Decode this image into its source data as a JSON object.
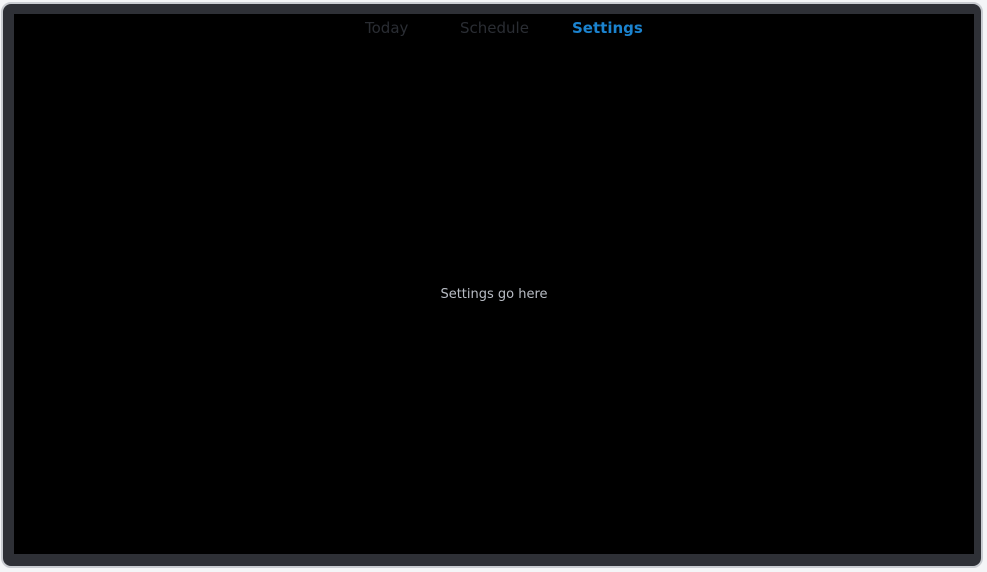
{
  "tabs": [
    {
      "label": "Today",
      "active": false
    },
    {
      "label": "Schedule",
      "active": false
    },
    {
      "label": "Settings",
      "active": true
    }
  ],
  "content": {
    "placeholder_text": "Settings go here"
  },
  "colors": {
    "active_tab": "#1b83cf",
    "inactive_tab": "#2a2d33",
    "screen_background": "#000000",
    "bezel": "#2e3036"
  }
}
